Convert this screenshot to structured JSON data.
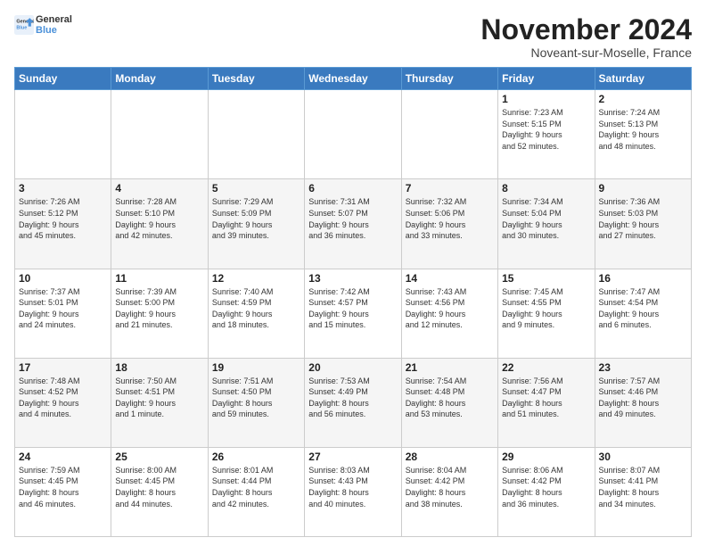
{
  "logo": {
    "line1": "General",
    "line2": "Blue"
  },
  "title": "November 2024",
  "location": "Noveant-sur-Moselle, France",
  "weekdays": [
    "Sunday",
    "Monday",
    "Tuesday",
    "Wednesday",
    "Thursday",
    "Friday",
    "Saturday"
  ],
  "weeks": [
    [
      {
        "day": "",
        "info": ""
      },
      {
        "day": "",
        "info": ""
      },
      {
        "day": "",
        "info": ""
      },
      {
        "day": "",
        "info": ""
      },
      {
        "day": "",
        "info": ""
      },
      {
        "day": "1",
        "info": "Sunrise: 7:23 AM\nSunset: 5:15 PM\nDaylight: 9 hours\nand 52 minutes."
      },
      {
        "day": "2",
        "info": "Sunrise: 7:24 AM\nSunset: 5:13 PM\nDaylight: 9 hours\nand 48 minutes."
      }
    ],
    [
      {
        "day": "3",
        "info": "Sunrise: 7:26 AM\nSunset: 5:12 PM\nDaylight: 9 hours\nand 45 minutes."
      },
      {
        "day": "4",
        "info": "Sunrise: 7:28 AM\nSunset: 5:10 PM\nDaylight: 9 hours\nand 42 minutes."
      },
      {
        "day": "5",
        "info": "Sunrise: 7:29 AM\nSunset: 5:09 PM\nDaylight: 9 hours\nand 39 minutes."
      },
      {
        "day": "6",
        "info": "Sunrise: 7:31 AM\nSunset: 5:07 PM\nDaylight: 9 hours\nand 36 minutes."
      },
      {
        "day": "7",
        "info": "Sunrise: 7:32 AM\nSunset: 5:06 PM\nDaylight: 9 hours\nand 33 minutes."
      },
      {
        "day": "8",
        "info": "Sunrise: 7:34 AM\nSunset: 5:04 PM\nDaylight: 9 hours\nand 30 minutes."
      },
      {
        "day": "9",
        "info": "Sunrise: 7:36 AM\nSunset: 5:03 PM\nDaylight: 9 hours\nand 27 minutes."
      }
    ],
    [
      {
        "day": "10",
        "info": "Sunrise: 7:37 AM\nSunset: 5:01 PM\nDaylight: 9 hours\nand 24 minutes."
      },
      {
        "day": "11",
        "info": "Sunrise: 7:39 AM\nSunset: 5:00 PM\nDaylight: 9 hours\nand 21 minutes."
      },
      {
        "day": "12",
        "info": "Sunrise: 7:40 AM\nSunset: 4:59 PM\nDaylight: 9 hours\nand 18 minutes."
      },
      {
        "day": "13",
        "info": "Sunrise: 7:42 AM\nSunset: 4:57 PM\nDaylight: 9 hours\nand 15 minutes."
      },
      {
        "day": "14",
        "info": "Sunrise: 7:43 AM\nSunset: 4:56 PM\nDaylight: 9 hours\nand 12 minutes."
      },
      {
        "day": "15",
        "info": "Sunrise: 7:45 AM\nSunset: 4:55 PM\nDaylight: 9 hours\nand 9 minutes."
      },
      {
        "day": "16",
        "info": "Sunrise: 7:47 AM\nSunset: 4:54 PM\nDaylight: 9 hours\nand 6 minutes."
      }
    ],
    [
      {
        "day": "17",
        "info": "Sunrise: 7:48 AM\nSunset: 4:52 PM\nDaylight: 9 hours\nand 4 minutes."
      },
      {
        "day": "18",
        "info": "Sunrise: 7:50 AM\nSunset: 4:51 PM\nDaylight: 9 hours\nand 1 minute."
      },
      {
        "day": "19",
        "info": "Sunrise: 7:51 AM\nSunset: 4:50 PM\nDaylight: 8 hours\nand 59 minutes."
      },
      {
        "day": "20",
        "info": "Sunrise: 7:53 AM\nSunset: 4:49 PM\nDaylight: 8 hours\nand 56 minutes."
      },
      {
        "day": "21",
        "info": "Sunrise: 7:54 AM\nSunset: 4:48 PM\nDaylight: 8 hours\nand 53 minutes."
      },
      {
        "day": "22",
        "info": "Sunrise: 7:56 AM\nSunset: 4:47 PM\nDaylight: 8 hours\nand 51 minutes."
      },
      {
        "day": "23",
        "info": "Sunrise: 7:57 AM\nSunset: 4:46 PM\nDaylight: 8 hours\nand 49 minutes."
      }
    ],
    [
      {
        "day": "24",
        "info": "Sunrise: 7:59 AM\nSunset: 4:45 PM\nDaylight: 8 hours\nand 46 minutes."
      },
      {
        "day": "25",
        "info": "Sunrise: 8:00 AM\nSunset: 4:45 PM\nDaylight: 8 hours\nand 44 minutes."
      },
      {
        "day": "26",
        "info": "Sunrise: 8:01 AM\nSunset: 4:44 PM\nDaylight: 8 hours\nand 42 minutes."
      },
      {
        "day": "27",
        "info": "Sunrise: 8:03 AM\nSunset: 4:43 PM\nDaylight: 8 hours\nand 40 minutes."
      },
      {
        "day": "28",
        "info": "Sunrise: 8:04 AM\nSunset: 4:42 PM\nDaylight: 8 hours\nand 38 minutes."
      },
      {
        "day": "29",
        "info": "Sunrise: 8:06 AM\nSunset: 4:42 PM\nDaylight: 8 hours\nand 36 minutes."
      },
      {
        "day": "30",
        "info": "Sunrise: 8:07 AM\nSunset: 4:41 PM\nDaylight: 8 hours\nand 34 minutes."
      }
    ]
  ]
}
